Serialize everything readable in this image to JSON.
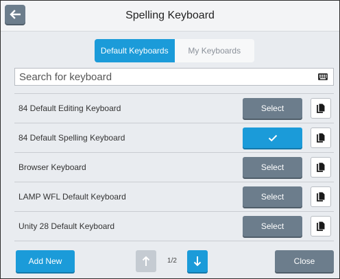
{
  "header": {
    "title": "Spelling Keyboard",
    "back_icon": "arrow-left-icon"
  },
  "tabs": [
    {
      "label": "Default Keyboards",
      "active": true
    },
    {
      "label": "My Keyboards",
      "active": false
    }
  ],
  "search": {
    "placeholder": "Search for keyboard",
    "value": "",
    "icon": "keyboard-icon"
  },
  "keyboards": [
    {
      "name": "84 Default Editing Keyboard",
      "action_label": "Select",
      "selected": false
    },
    {
      "name": "84 Default Spelling Keyboard",
      "action_label": "",
      "selected": true,
      "action_icon": "checkmark-icon"
    },
    {
      "name": "Browser Keyboard",
      "action_label": "Select",
      "selected": false
    },
    {
      "name": "LAMP WFL Default Keyboard",
      "action_label": "Select",
      "selected": false
    },
    {
      "name": "Unity 28 Default Keyboard",
      "action_label": "Select",
      "selected": false
    }
  ],
  "row_icon": "copy-icon",
  "footer": {
    "add_new_label": "Add New",
    "page_indicator": "1/2",
    "close_label": "Close",
    "page_up_icon": "arrow-up-icon",
    "page_down_icon": "arrow-down-icon"
  },
  "colors": {
    "accent": "#1b9bd9",
    "button_gray": "#6c7d8c",
    "background": "#e9ecf0"
  }
}
